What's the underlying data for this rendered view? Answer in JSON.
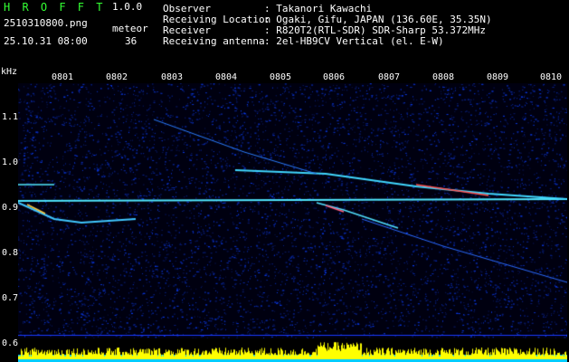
{
  "header": {
    "app_title": "H R O F F T",
    "version": "1.0.0",
    "filename": "2510310800.png",
    "datetime": "25.10.31 08:00",
    "meteor_label": "meteor",
    "meteor_count": "36",
    "info": [
      {
        "key": "Observer",
        "value": ": Takanori Kawachi"
      },
      {
        "key": "Receiving Location",
        "value": ": Ogaki, Gifu, JAPAN (136.60E, 35.35N)"
      },
      {
        "key": "Receiver",
        "value": ": R820T2(RTL-SDR) SDR-Sharp 53.372MHz"
      },
      {
        "key": "Receiving antenna",
        "value": ": 2el-HB9CV Vertical (el. E-W)"
      }
    ]
  },
  "axis": {
    "unit": "kHz",
    "x_ticks": [
      "0801",
      "0802",
      "0803",
      "0804",
      "0805",
      "0806",
      "0807",
      "0808",
      "0809",
      "0810"
    ],
    "y_ticks": [
      "1.1",
      "1.0",
      "0.9",
      "0.8",
      "0.7",
      "0.6"
    ]
  },
  "colors": {
    "title_green": "#33ff33",
    "background": "#000000",
    "noise_blue": "#0a2ad8",
    "echo_cyan": "#40e0ff",
    "bar_yellow": "#ffff00",
    "bar_cyan": "#00ccff"
  }
}
